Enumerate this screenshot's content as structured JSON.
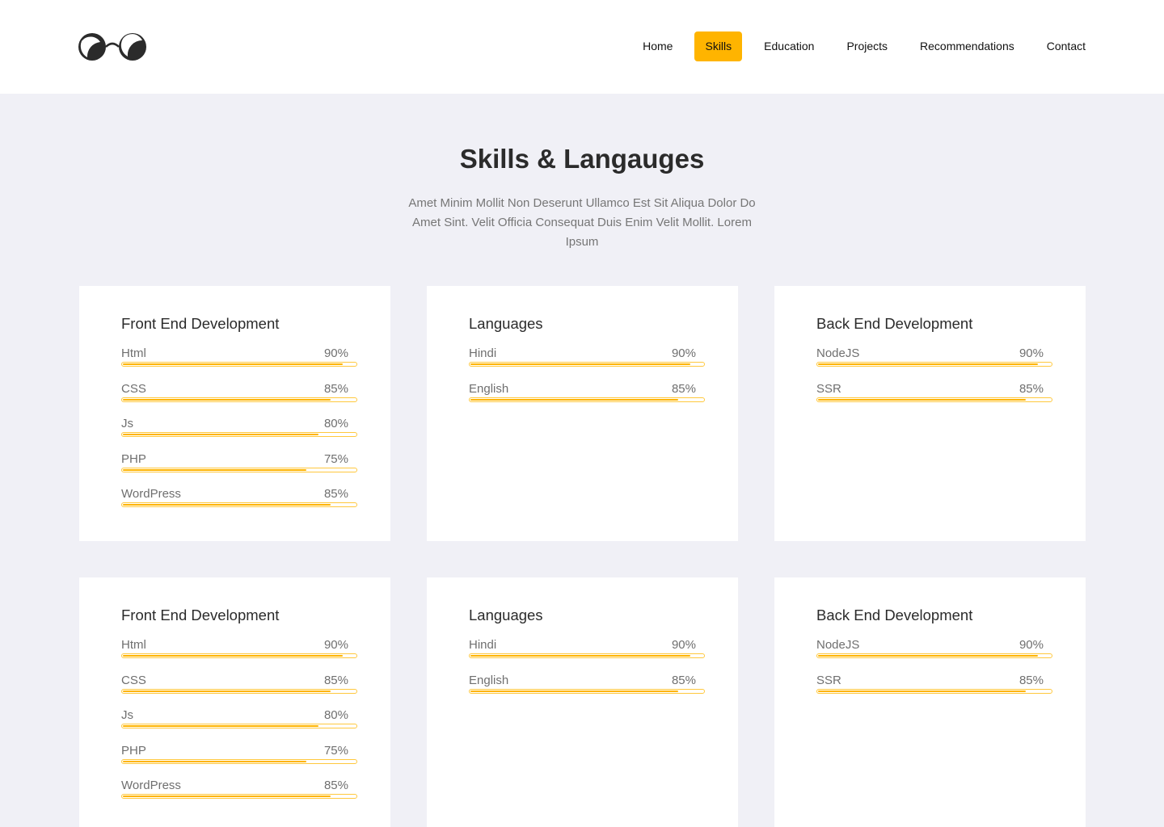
{
  "header": {
    "nav": [
      {
        "label": "Home",
        "active": false
      },
      {
        "label": "Skills",
        "active": true
      },
      {
        "label": "Education",
        "active": false
      },
      {
        "label": "Projects",
        "active": false
      },
      {
        "label": "Recommendations",
        "active": false
      },
      {
        "label": "Contact",
        "active": false
      }
    ]
  },
  "section": {
    "title": "Skills & Langauges",
    "subtitle": "Amet Minim Mollit Non Deserunt Ullamco Est Sit Aliqua Dolor Do Amet Sint. Velit Officia Consequat Duis Enim Velit Mollit. Lorem Ipsum"
  },
  "colors": {
    "accent": "#ffb400",
    "background": "#f0f0f6",
    "card": "#ffffff"
  },
  "cards": [
    {
      "title": "Front End Development",
      "skills": [
        {
          "name": "Html",
          "percent": "90%",
          "value": 90
        },
        {
          "name": "CSS",
          "percent": "85%",
          "value": 85
        },
        {
          "name": "Js",
          "percent": "80%",
          "value": 80
        },
        {
          "name": "PHP",
          "percent": "75%",
          "value": 75
        },
        {
          "name": "WordPress",
          "percent": "85%",
          "value": 85
        }
      ]
    },
    {
      "title": "Languages",
      "skills": [
        {
          "name": "Hindi",
          "percent": "90%",
          "value": 90
        },
        {
          "name": "English",
          "percent": "85%",
          "value": 85
        }
      ]
    },
    {
      "title": "Back End Development",
      "skills": [
        {
          "name": "NodeJS",
          "percent": "90%",
          "value": 90
        },
        {
          "name": "SSR",
          "percent": "85%",
          "value": 85
        }
      ]
    },
    {
      "title": "Front End Development",
      "skills": [
        {
          "name": "Html",
          "percent": "90%",
          "value": 90
        },
        {
          "name": "CSS",
          "percent": "85%",
          "value": 85
        },
        {
          "name": "Js",
          "percent": "80%",
          "value": 80
        },
        {
          "name": "PHP",
          "percent": "75%",
          "value": 75
        },
        {
          "name": "WordPress",
          "percent": "85%",
          "value": 85
        }
      ]
    },
    {
      "title": "Languages",
      "skills": [
        {
          "name": "Hindi",
          "percent": "90%",
          "value": 90
        },
        {
          "name": "English",
          "percent": "85%",
          "value": 85
        }
      ]
    },
    {
      "title": "Back End Development",
      "skills": [
        {
          "name": "NodeJS",
          "percent": "90%",
          "value": 90
        },
        {
          "name": "SSR",
          "percent": "85%",
          "value": 85
        }
      ]
    }
  ]
}
